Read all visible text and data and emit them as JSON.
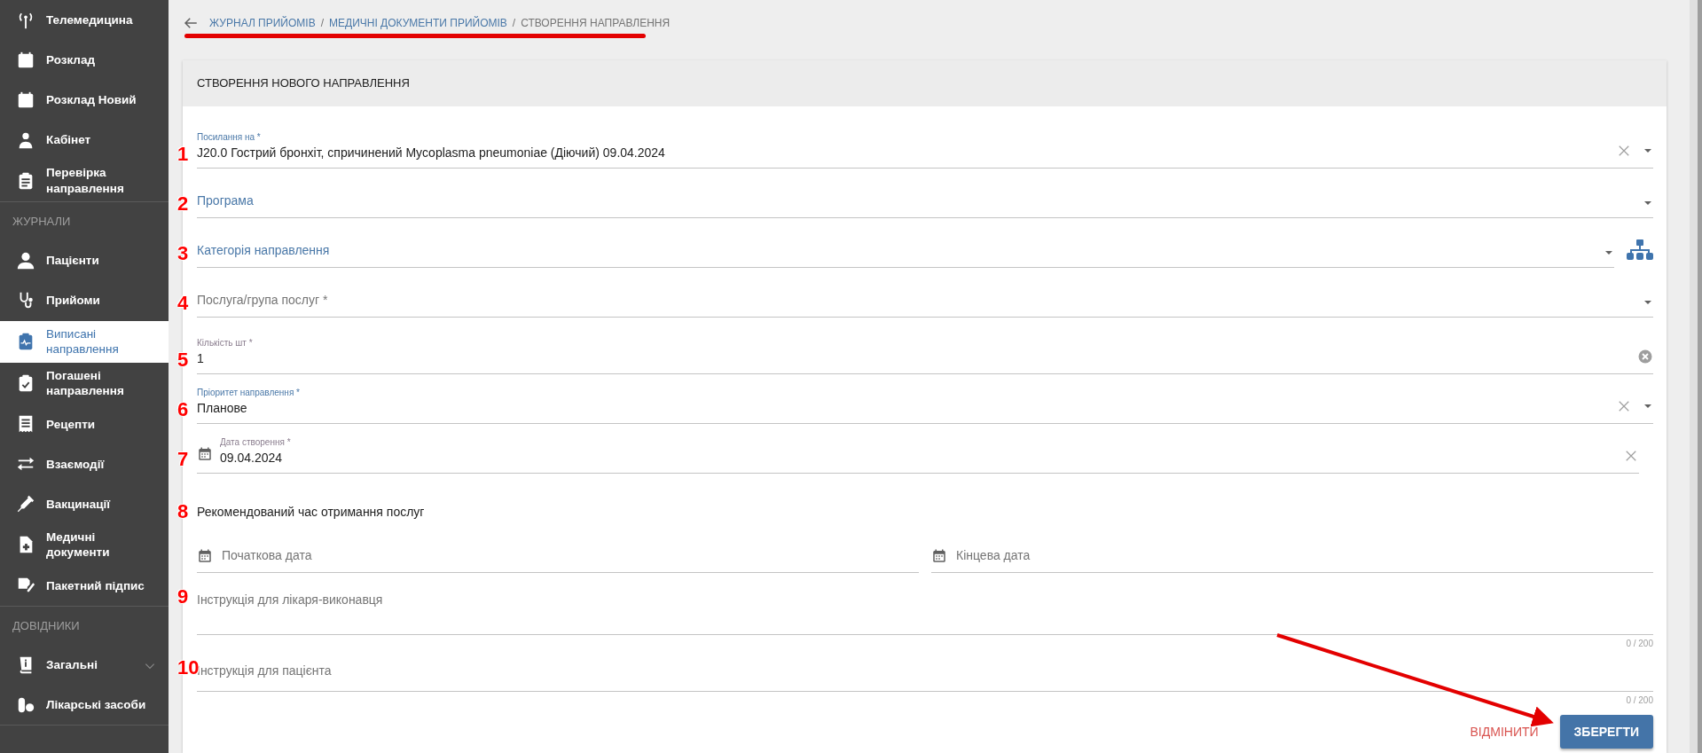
{
  "sidebar": {
    "sections": [
      {
        "items": [
          {
            "label": "Телемедицина",
            "selected": false,
            "expandable": false
          },
          {
            "label": "Розклад",
            "selected": false,
            "expandable": false
          },
          {
            "label": "Розклад Новий",
            "selected": false,
            "expandable": false
          },
          {
            "label": "Кабінет",
            "selected": false,
            "expandable": false
          },
          {
            "label": "Перевірка направлення",
            "selected": false,
            "expandable": false
          }
        ]
      },
      {
        "title": "ЖУРНАЛИ",
        "items": [
          {
            "label": "Пацієнти",
            "selected": false,
            "expandable": false
          },
          {
            "label": "Прийоми",
            "selected": false,
            "expandable": false
          },
          {
            "label": "Виписані направлення",
            "selected": true,
            "expandable": false
          },
          {
            "label": "Погашені направлення",
            "selected": false,
            "expandable": false
          },
          {
            "label": "Рецепти",
            "selected": false,
            "expandable": false
          },
          {
            "label": "Взаємодії",
            "selected": false,
            "expandable": false
          },
          {
            "label": "Вакцинації",
            "selected": false,
            "expandable": false
          },
          {
            "label": "Медичні документи",
            "selected": false,
            "expandable": false
          },
          {
            "label": "Пакетний підпис",
            "selected": false,
            "expandable": false
          }
        ]
      },
      {
        "title": "ДОВІДНИКИ",
        "items": [
          {
            "label": "Загальні",
            "selected": false,
            "expandable": true
          },
          {
            "label": "Лікарські засоби",
            "selected": false,
            "expandable": false
          }
        ]
      }
    ]
  },
  "breadcrumb": [
    {
      "kind": "crumb",
      "label": "ЖУРНАЛ ПРИЙОМІВ",
      "current": false
    },
    {
      "kind": "separator",
      "label": "/"
    },
    {
      "kind": "crumb",
      "label": "МЕДИЧНІ ДОКУМЕНТИ ПРИЙОМІВ",
      "current": false
    },
    {
      "kind": "separator",
      "label": "/"
    },
    {
      "kind": "crumb",
      "label": "СТВОРЕННЯ НАПРАВЛЕННЯ",
      "current": true
    }
  ],
  "card": {
    "title": "СТВОРЕННЯ НОВОГО НАПРАВЛЕННЯ",
    "fields": [
      {
        "kind": "select",
        "marker": "1",
        "label": "Посилання на *",
        "value": "J20.0 Гострий бронхіт, спричинений Mycoplasma pneumoniae (Діючий) 09.04.2024",
        "highlighted": true,
        "clearable": true,
        "tree_button": false
      },
      {
        "kind": "select",
        "marker": "2",
        "label": "Програма",
        "highlighted": true,
        "clearable": false,
        "tree_button": false
      },
      {
        "kind": "select",
        "marker": "3",
        "label": "Категорія направлення",
        "highlighted": true,
        "clearable": false,
        "tree_button": true
      },
      {
        "kind": "select",
        "marker": "4",
        "label": "Послуга/група послуг *",
        "highlighted": false,
        "clearable": false,
        "tree_button": false
      },
      {
        "kind": "input",
        "marker": "5",
        "label": "Кількість шт *",
        "value": "1",
        "highlighted": false,
        "clearable": true
      },
      {
        "kind": "select",
        "marker": "6",
        "label": "Пріоритет направлення *",
        "value": "Планове",
        "highlighted": true,
        "clearable": true,
        "tree_button": false
      },
      {
        "kind": "date",
        "marker": "7",
        "label": "Дата створення *",
        "value": "09.04.2024",
        "highlighted": false,
        "clearable": true
      },
      {
        "kind": "heading",
        "marker": "8",
        "label": "Рекомендований час отримання послуг"
      },
      {
        "kind": "date_range",
        "placeholders": [
          "Початкова дата",
          "Кінцева дата"
        ]
      },
      {
        "kind": "textarea",
        "marker": "9",
        "label": "Інструкція для лікаря-виконавця",
        "counter": "0 / 200"
      },
      {
        "kind": "textarea",
        "marker": "10",
        "label": "Інструкція для пацієнта",
        "counter": "0 / 200"
      }
    ],
    "actions": [
      {
        "kind": "cancel",
        "label": "ВІДМІНИТИ"
      },
      {
        "kind": "save",
        "label": "ЗБЕРЕГТИ"
      }
    ]
  }
}
